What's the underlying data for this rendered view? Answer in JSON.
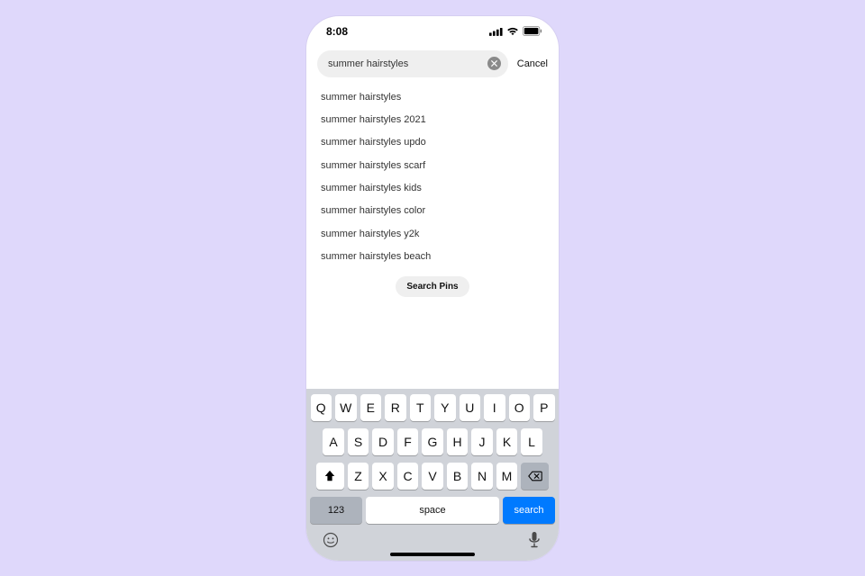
{
  "status": {
    "time": "8:08"
  },
  "search": {
    "query": "summer hairstyles",
    "cancel_label": "Cancel",
    "pins_button_label": "Search Pins"
  },
  "suggestions": [
    "summer hairstyles",
    "summer hairstyles 2021",
    "summer hairstyles updo",
    "summer hairstyles scarf",
    "summer hairstyles kids",
    "summer hairstyles color",
    "summer hairstyles y2k",
    "summer hairstyles beach"
  ],
  "keyboard": {
    "row1": [
      "Q",
      "W",
      "E",
      "R",
      "T",
      "Y",
      "U",
      "I",
      "O",
      "P"
    ],
    "row2": [
      "A",
      "S",
      "D",
      "F",
      "G",
      "H",
      "J",
      "K",
      "L"
    ],
    "row3": [
      "Z",
      "X",
      "C",
      "V",
      "B",
      "N",
      "M"
    ],
    "num_label": "123",
    "space_label": "space",
    "action_label": "search"
  }
}
